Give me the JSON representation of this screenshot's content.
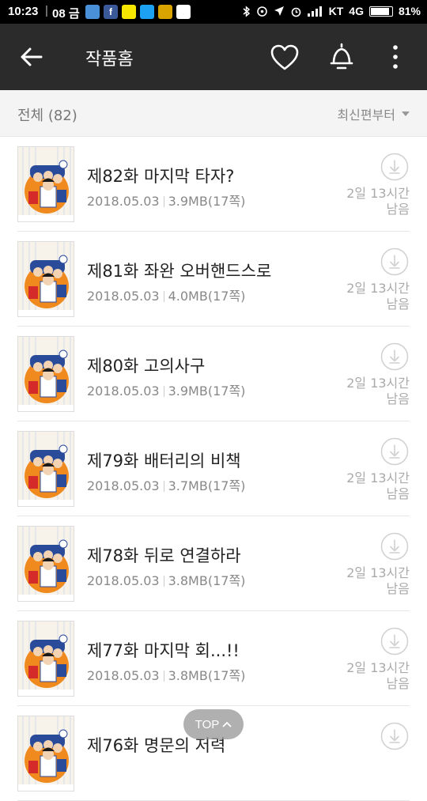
{
  "status_bar": {
    "time": "10:23",
    "date": "08 금",
    "carrier": "KT",
    "network": "4G",
    "battery": "81%",
    "battery_level": 0.81,
    "notification_icons": [
      "mailbox-icon",
      "facebook-icon",
      "kakaotalk-icon",
      "twitter-icon",
      "gallery-icon",
      "calendar-icon"
    ]
  },
  "header": {
    "title": "작품홈"
  },
  "filter": {
    "total": "전체 (82)",
    "sort": "최신편부터"
  },
  "episodes": [
    {
      "title": "제82화 마지막 타자?",
      "date": "2018.05.03",
      "size": "3.9MB(17쪽)",
      "remain_line1": "2일 13시간",
      "remain_line2": "남음"
    },
    {
      "title": "제81화 좌완 오버핸드스로",
      "date": "2018.05.03",
      "size": "4.0MB(17쪽)",
      "remain_line1": "2일 13시간",
      "remain_line2": "남음"
    },
    {
      "title": "제80화 고의사구",
      "date": "2018.05.03",
      "size": "3.9MB(17쪽)",
      "remain_line1": "2일 13시간",
      "remain_line2": "남음"
    },
    {
      "title": "제79화 배터리의 비책",
      "date": "2018.05.03",
      "size": "3.7MB(17쪽)",
      "remain_line1": "2일 13시간",
      "remain_line2": "남음"
    },
    {
      "title": "제78화 뒤로 연결하라",
      "date": "2018.05.03",
      "size": "3.8MB(17쪽)",
      "remain_line1": "2일 13시간",
      "remain_line2": "남음"
    },
    {
      "title": "제77화 마지막 회...!!",
      "date": "2018.05.03",
      "size": "3.8MB(17쪽)",
      "remain_line1": "2일 13시간",
      "remain_line2": "남음"
    },
    {
      "title": "제76화 명문의 저력",
      "date": "",
      "size": "",
      "remain_line1": "",
      "remain_line2": ""
    }
  ],
  "top_button": "TOP",
  "colors": {
    "app_bar": "#2b2b2b",
    "filter_bg": "#f4f4f4",
    "cover_red": "#d42a2a",
    "cover_orange": "#f08a1e",
    "cover_blue": "#2a4a9a"
  }
}
